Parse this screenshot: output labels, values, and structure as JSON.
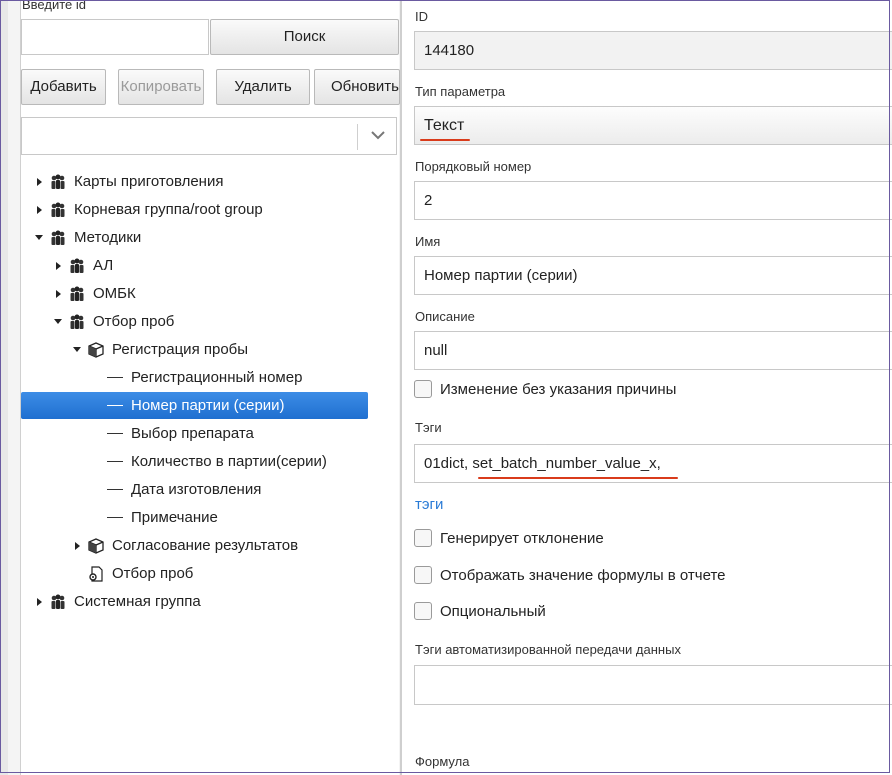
{
  "left": {
    "search_label": "Введите id",
    "search_button": "Поиск",
    "toolbar": {
      "add": "Добавить",
      "copy": "Копировать",
      "delete": "Удалить",
      "refresh": "Обновить"
    },
    "tree": [
      {
        "label": "Карты приготовления",
        "level": 0,
        "icon": "group-icon",
        "expander": "collapsed"
      },
      {
        "label": "Корневая группа/root group",
        "level": 0,
        "icon": "group-icon",
        "expander": "collapsed"
      },
      {
        "label": "Методики",
        "level": 0,
        "icon": "group-icon",
        "expander": "expanded"
      },
      {
        "label": "АЛ",
        "level": 1,
        "icon": "group-icon",
        "expander": "collapsed"
      },
      {
        "label": "ОМБК",
        "level": 1,
        "icon": "group-icon",
        "expander": "collapsed"
      },
      {
        "label": "Отбор проб",
        "level": 1,
        "icon": "group-icon",
        "expander": "expanded"
      },
      {
        "label": "Регистрация пробы",
        "level": 2,
        "icon": "box-icon",
        "expander": "expanded"
      },
      {
        "label": "Регистрационный номер",
        "level": 3,
        "icon": "dash",
        "expander": "none"
      },
      {
        "label": "Номер партии (серии)",
        "level": 3,
        "icon": "dash",
        "expander": "none",
        "selected": true
      },
      {
        "label": "Выбор препарата",
        "level": 3,
        "icon": "dash",
        "expander": "none"
      },
      {
        "label": "Количество в партии(серии)",
        "level": 3,
        "icon": "dash",
        "expander": "none"
      },
      {
        "label": "Дата изготовления",
        "level": 3,
        "icon": "dash",
        "expander": "none"
      },
      {
        "label": "Примечание",
        "level": 3,
        "icon": "dash",
        "expander": "none"
      },
      {
        "label": "Согласование результатов",
        "level": 2,
        "icon": "box-icon",
        "expander": "collapsed"
      },
      {
        "label": "Отбор проб",
        "level": 2,
        "icon": "document-gear-icon",
        "expander": "none"
      },
      {
        "label": "Системная группа",
        "level": 0,
        "icon": "group-icon",
        "expander": "collapsed"
      }
    ]
  },
  "form": {
    "id_label": "ID",
    "id_value": "144180",
    "type_label": "Тип параметра",
    "type_value": "Текст",
    "order_label": "Порядковый номер",
    "order_value": "2",
    "name_label": "Имя",
    "name_value": "Номер партии (серии)",
    "desc_label": "Описание",
    "desc_value": "null",
    "change_no_reason": "Изменение без указания причины",
    "tags_label": "Тэги",
    "tags_value": "01dict, set_batch_number_value_x,",
    "tags_link": "тэги",
    "generates_deviation": "Генерирует отклонение",
    "show_formula_value": "Отображать значение формулы в отчете",
    "optional": "Опциональный",
    "auto_tags_label": "Тэги автоматизированной передачи данных",
    "auto_tags_value": "",
    "formula_label": "Формула"
  },
  "colors": {
    "selection": "#2a7bd6",
    "annotation_red": "#d93b1b",
    "link": "#2a7bd6"
  }
}
